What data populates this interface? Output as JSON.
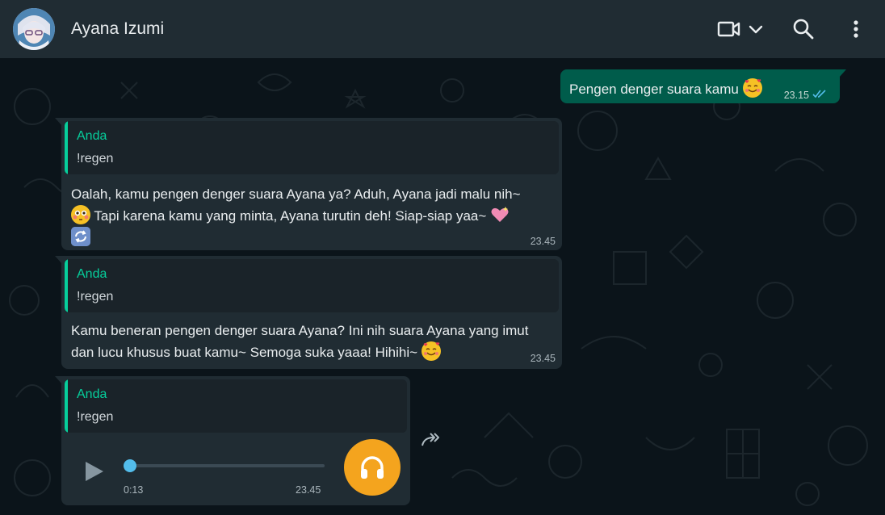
{
  "header": {
    "contact_name": "Ayana Izumi",
    "icons": [
      "video-call-icon",
      "chevron-down-icon",
      "search-icon",
      "more-vert-icon"
    ]
  },
  "messages": {
    "outgoing": {
      "text": "Pengen denger suara kamu",
      "time": "23.15",
      "status": "read"
    },
    "reply1": {
      "quote_author": "Anda",
      "quote_text": "!regen",
      "line1": "Oalah, kamu pengen denger suara Ayana ya? Aduh, Ayana jadi malu nih~",
      "line2": " Tapi karena kamu yang minta, Ayana turutin deh! Siap-siap yaa~ ",
      "time": "23.45"
    },
    "reply2": {
      "quote_author": "Anda",
      "quote_text": "!regen",
      "line1": "Kamu beneran pengen denger suara Ayana? Ini nih suara Ayana yang imut",
      "line2": "dan lucu khusus buat kamu~ Semoga suka yaaa! Hihihi~ ",
      "time": "23.45"
    },
    "voice": {
      "quote_author": "Anda",
      "quote_text": "!regen",
      "duration": "0:13",
      "time": "23.45",
      "progress": 0
    }
  },
  "colors": {
    "header_bg": "#202c33",
    "chat_bg": "#0b141a",
    "outgoing_bubble": "#005c4b",
    "incoming_bubble": "#202c33",
    "accent": "#06cf9c",
    "audio_button": "#f4a41e",
    "read_ticks": "#53bdeb"
  }
}
